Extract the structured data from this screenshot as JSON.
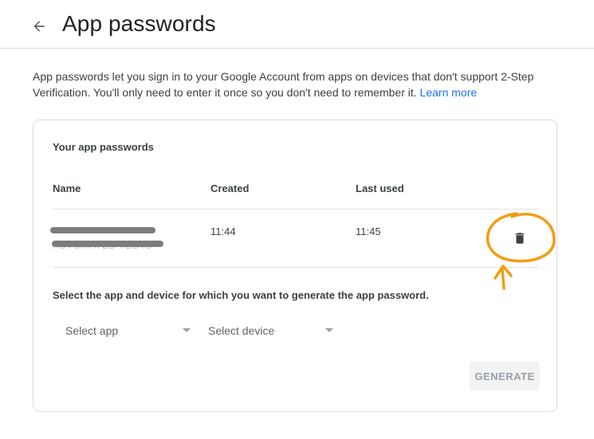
{
  "header": {
    "title": "App passwords",
    "back_icon": "arrow-back-icon"
  },
  "intro": {
    "text": "App passwords let you sign in to your Google Account from apps on devices that don't support 2-Step Verification. You'll only need to enter it once so you don't need to remember it. ",
    "learn_more": "Learn more"
  },
  "card": {
    "title": "Your app passwords",
    "columns": {
      "name": "Name",
      "created": "Created",
      "last_used": "Last used"
    },
    "rows": [
      {
        "name": "AUTOMATED TESTS",
        "created": "11:44",
        "last_used": "11:45",
        "delete_icon": "trash-icon"
      }
    ],
    "select_prompt": "Select the app and device for which you want to generate the app password.",
    "select_app": "Select app",
    "select_device": "Select device",
    "generate": "GENERATE"
  },
  "colors": {
    "link": "#1a73e8",
    "annotation": "#f39c12",
    "disabled_button_bg": "#f1f3f4",
    "disabled_button_text": "#9aa0a6"
  }
}
